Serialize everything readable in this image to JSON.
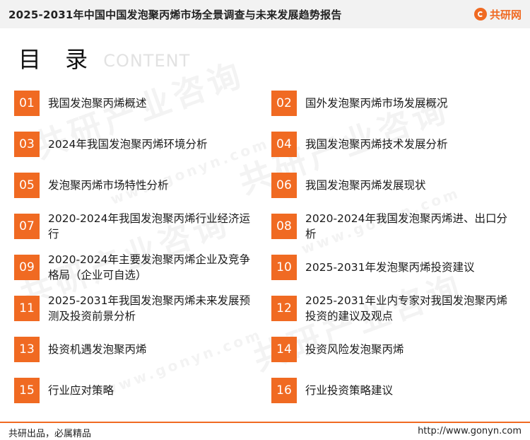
{
  "header": {
    "title": "2025-2031年中国中国发泡聚丙烯市场全景调查与未来发展趋势报告",
    "brand_name": "共研网",
    "brand_icon": "gonyn-logo-icon"
  },
  "toc_heading": {
    "cn": "目 录",
    "en": "CONTENT"
  },
  "watermark": {
    "text": "共研产业咨询",
    "url_text": "www.gonyn.com"
  },
  "colors": {
    "accent": "#f06a22",
    "topbar_bg": "#f2f2f2"
  },
  "toc": {
    "items": [
      {
        "num": "01",
        "label": "我国发泡聚丙烯概述"
      },
      {
        "num": "02",
        "label": "国外发泡聚丙烯市场发展概况"
      },
      {
        "num": "03",
        "label": "2024年我国发泡聚丙烯环境分析"
      },
      {
        "num": "04",
        "label": "我国发泡聚丙烯技术发展分析"
      },
      {
        "num": "05",
        "label": "发泡聚丙烯市场特性分析"
      },
      {
        "num": "06",
        "label": "我国发泡聚丙烯发展现状"
      },
      {
        "num": "07",
        "label": "2020-2024年我国发泡聚丙烯行业经济运行"
      },
      {
        "num": "08",
        "label": "2020-2024年我国发泡聚丙烯进、出口分析"
      },
      {
        "num": "09",
        "label": "2020-2024年主要发泡聚丙烯企业及竞争格局（企业可自选）"
      },
      {
        "num": "10",
        "label": "2025-2031年发泡聚丙烯投资建议"
      },
      {
        "num": "11",
        "label": "2025-2031年我国发泡聚丙烯未来发展预测及投资前景分析"
      },
      {
        "num": "12",
        "label": "2025-2031年业内专家对我国发泡聚丙烯投资的建议及观点"
      },
      {
        "num": "13",
        "label": "投资机遇发泡聚丙烯"
      },
      {
        "num": "14",
        "label": "投资风险发泡聚丙烯"
      },
      {
        "num": "15",
        "label": "行业应对策略"
      },
      {
        "num": "16",
        "label": "行业投资策略建议"
      }
    ]
  },
  "footer": {
    "slogan": "共研出品，必属精品",
    "url": "http://www.gonyn.com"
  }
}
